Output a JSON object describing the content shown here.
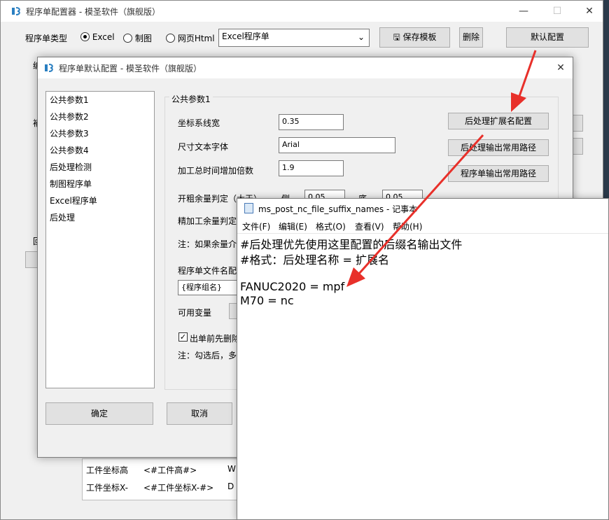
{
  "main": {
    "title": "程序单配置器 - 模圣软件（旗舰版）",
    "type_label": "程序单类型",
    "radios": [
      {
        "label": "Excel",
        "checked": true
      },
      {
        "label": "制图",
        "checked": false
      },
      {
        "label": "网页Html",
        "checked": false
      }
    ],
    "template_select": "Excel程序单",
    "save_button": "保存模板",
    "delete_button": "删除",
    "default_button": "默认配置",
    "partial_labels": [
      "编",
      "補",
      "回"
    ],
    "table_rows": [
      {
        "name": "工件坐标高",
        "value": "<#工件高#>",
        "extra": "W"
      },
      {
        "name": "工件坐标X-",
        "value": "<#工件坐标X-#>",
        "extra": "D"
      }
    ]
  },
  "dialog": {
    "title": "程序单默认配置 - 模圣软件（旗舰版）",
    "nav_items": [
      "公共参数1",
      "公共参数2",
      "公共参数3",
      "公共参数4",
      "后处理检测",
      "制图程序单",
      "Excel程序单",
      "后处理"
    ],
    "group_title": "公共参数1",
    "fields": [
      {
        "label": "坐标系线宽",
        "value": "0.35"
      },
      {
        "label": "尺寸文本字体",
        "value": "Arial"
      },
      {
        "label": "加工总时间增加倍数",
        "value": "1.9"
      }
    ],
    "rough_label": "开粗余量判定（大于）",
    "side_label": "侧",
    "side_value": "0.05",
    "bottom_label": "底",
    "bottom_value": "0.05",
    "finish_label": "精加工余量判定",
    "note1": "注：如果余量介",
    "filename_label": "程序单文件名配",
    "filename_value": "{程序组名}",
    "vars_label": "可用变量",
    "checkbox_label": "出单前先删除",
    "note2": "注：勾选后，多",
    "buttons": {
      "ext_config": "后处理扩展名配置",
      "output_path": "后处理输出常用路径",
      "sheet_path": "程序单输出常用路径",
      "ok": "确定",
      "cancel": "取消"
    }
  },
  "notepad": {
    "title": "ms_post_nc_file_suffix_names - 记事本",
    "menu": [
      "文件(F)",
      "编辑(E)",
      "格式(O)",
      "查看(V)",
      "帮助(H)"
    ],
    "lines": [
      "#后处理优先使用这里配置的后缀名输出文件",
      "#格式：后处理名称 = 扩展名",
      "",
      "FANUC2020 = mpf",
      "M70 = nc"
    ]
  },
  "colors": {
    "arrow": "#e8302a",
    "logo": "#2a7fc1"
  }
}
